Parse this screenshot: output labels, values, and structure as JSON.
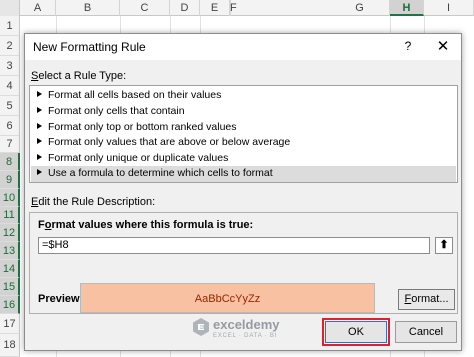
{
  "spreadsheet": {
    "columns": [
      "A",
      "B",
      "C",
      "D",
      "E",
      "F",
      "G",
      "H",
      "I"
    ],
    "selected_column": "H",
    "rows": [
      "1",
      "2",
      "3",
      "4",
      "5",
      "6",
      "7",
      "8",
      "9",
      "10",
      "11",
      "12",
      "13",
      "14",
      "15",
      "16",
      "17",
      "18"
    ],
    "selected_rows": [
      "8",
      "9",
      "10",
      "11",
      "12",
      "13",
      "14",
      "15",
      "16"
    ]
  },
  "dialog": {
    "title": "New Formatting Rule",
    "help_glyph": "?",
    "close_glyph": "✕",
    "select_type_label_prefix": "S",
    "select_type_label_rest": "elect a Rule Type:",
    "rule_types": [
      "Format all cells based on their values",
      "Format only cells that contain",
      "Format only top or bottom ranked values",
      "Format only values that are above or below average",
      "Format only unique or duplicate values",
      "Use a formula to determine which cells to format"
    ],
    "selected_rule_index": 5,
    "edit_desc_label_prefix": "E",
    "edit_desc_label_rest": "dit the Rule Description:",
    "formula_label_prefix": "F",
    "formula_label_middle": "o",
    "formula_label_rest": "rmat values where this formula is true:",
    "formula_value": "=$H8",
    "collapse_glyph": "⬆",
    "preview_label": "Preview:",
    "preview_text": "AaBbCcYyZz",
    "format_button_prefix": "F",
    "format_button_rest": "ormat...",
    "ok_label": "OK",
    "cancel_label": "Cancel"
  },
  "watermark": {
    "name": "exceldemy",
    "tagline": "EXCEL · DATA · BI"
  },
  "colors": {
    "preview_fill": "#f8c1a1",
    "preview_text": "#9b2500",
    "selection_green": "#217346",
    "ok_highlight": "#e0202b"
  }
}
